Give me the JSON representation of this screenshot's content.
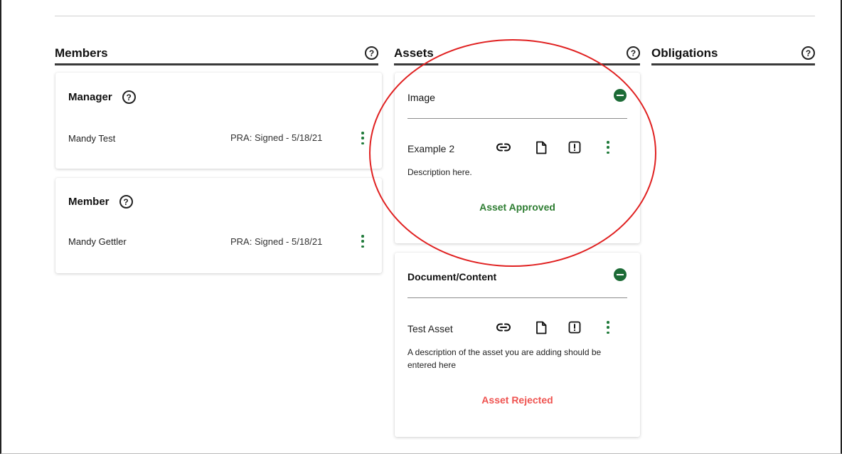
{
  "colors": {
    "accent_green": "#1f7a3a",
    "approved": "#2e7d32",
    "rejected": "#ef5350",
    "annotation": "#e02020"
  },
  "icons": {
    "help": "question-circle-icon",
    "link": "link-icon",
    "file": "file-icon",
    "alert": "alert-square-icon",
    "more": "kebab-menu-icon",
    "remove": "minus-circle-icon"
  },
  "columns": {
    "members": {
      "title": "Members",
      "help": "?"
    },
    "assets": {
      "title": "Assets",
      "help": "?"
    },
    "obligations": {
      "title": "Obligations",
      "help": "?"
    }
  },
  "members": {
    "manager": {
      "role": "Manager",
      "help": "?",
      "name": "Mandy Test",
      "status": "PRA: Signed - 5/18/21"
    },
    "member": {
      "role": "Member",
      "help": "?",
      "name": "Mandy Gettler",
      "status": "PRA: Signed - 5/18/21"
    }
  },
  "assets": {
    "image": {
      "type": "Image",
      "name": "Example 2",
      "description": "Description here.",
      "status": "Asset Approved"
    },
    "document": {
      "type": "Document/Content",
      "name": "Test Asset",
      "description": "A description of the asset you are adding should be entered here",
      "status": "Asset Rejected"
    }
  }
}
